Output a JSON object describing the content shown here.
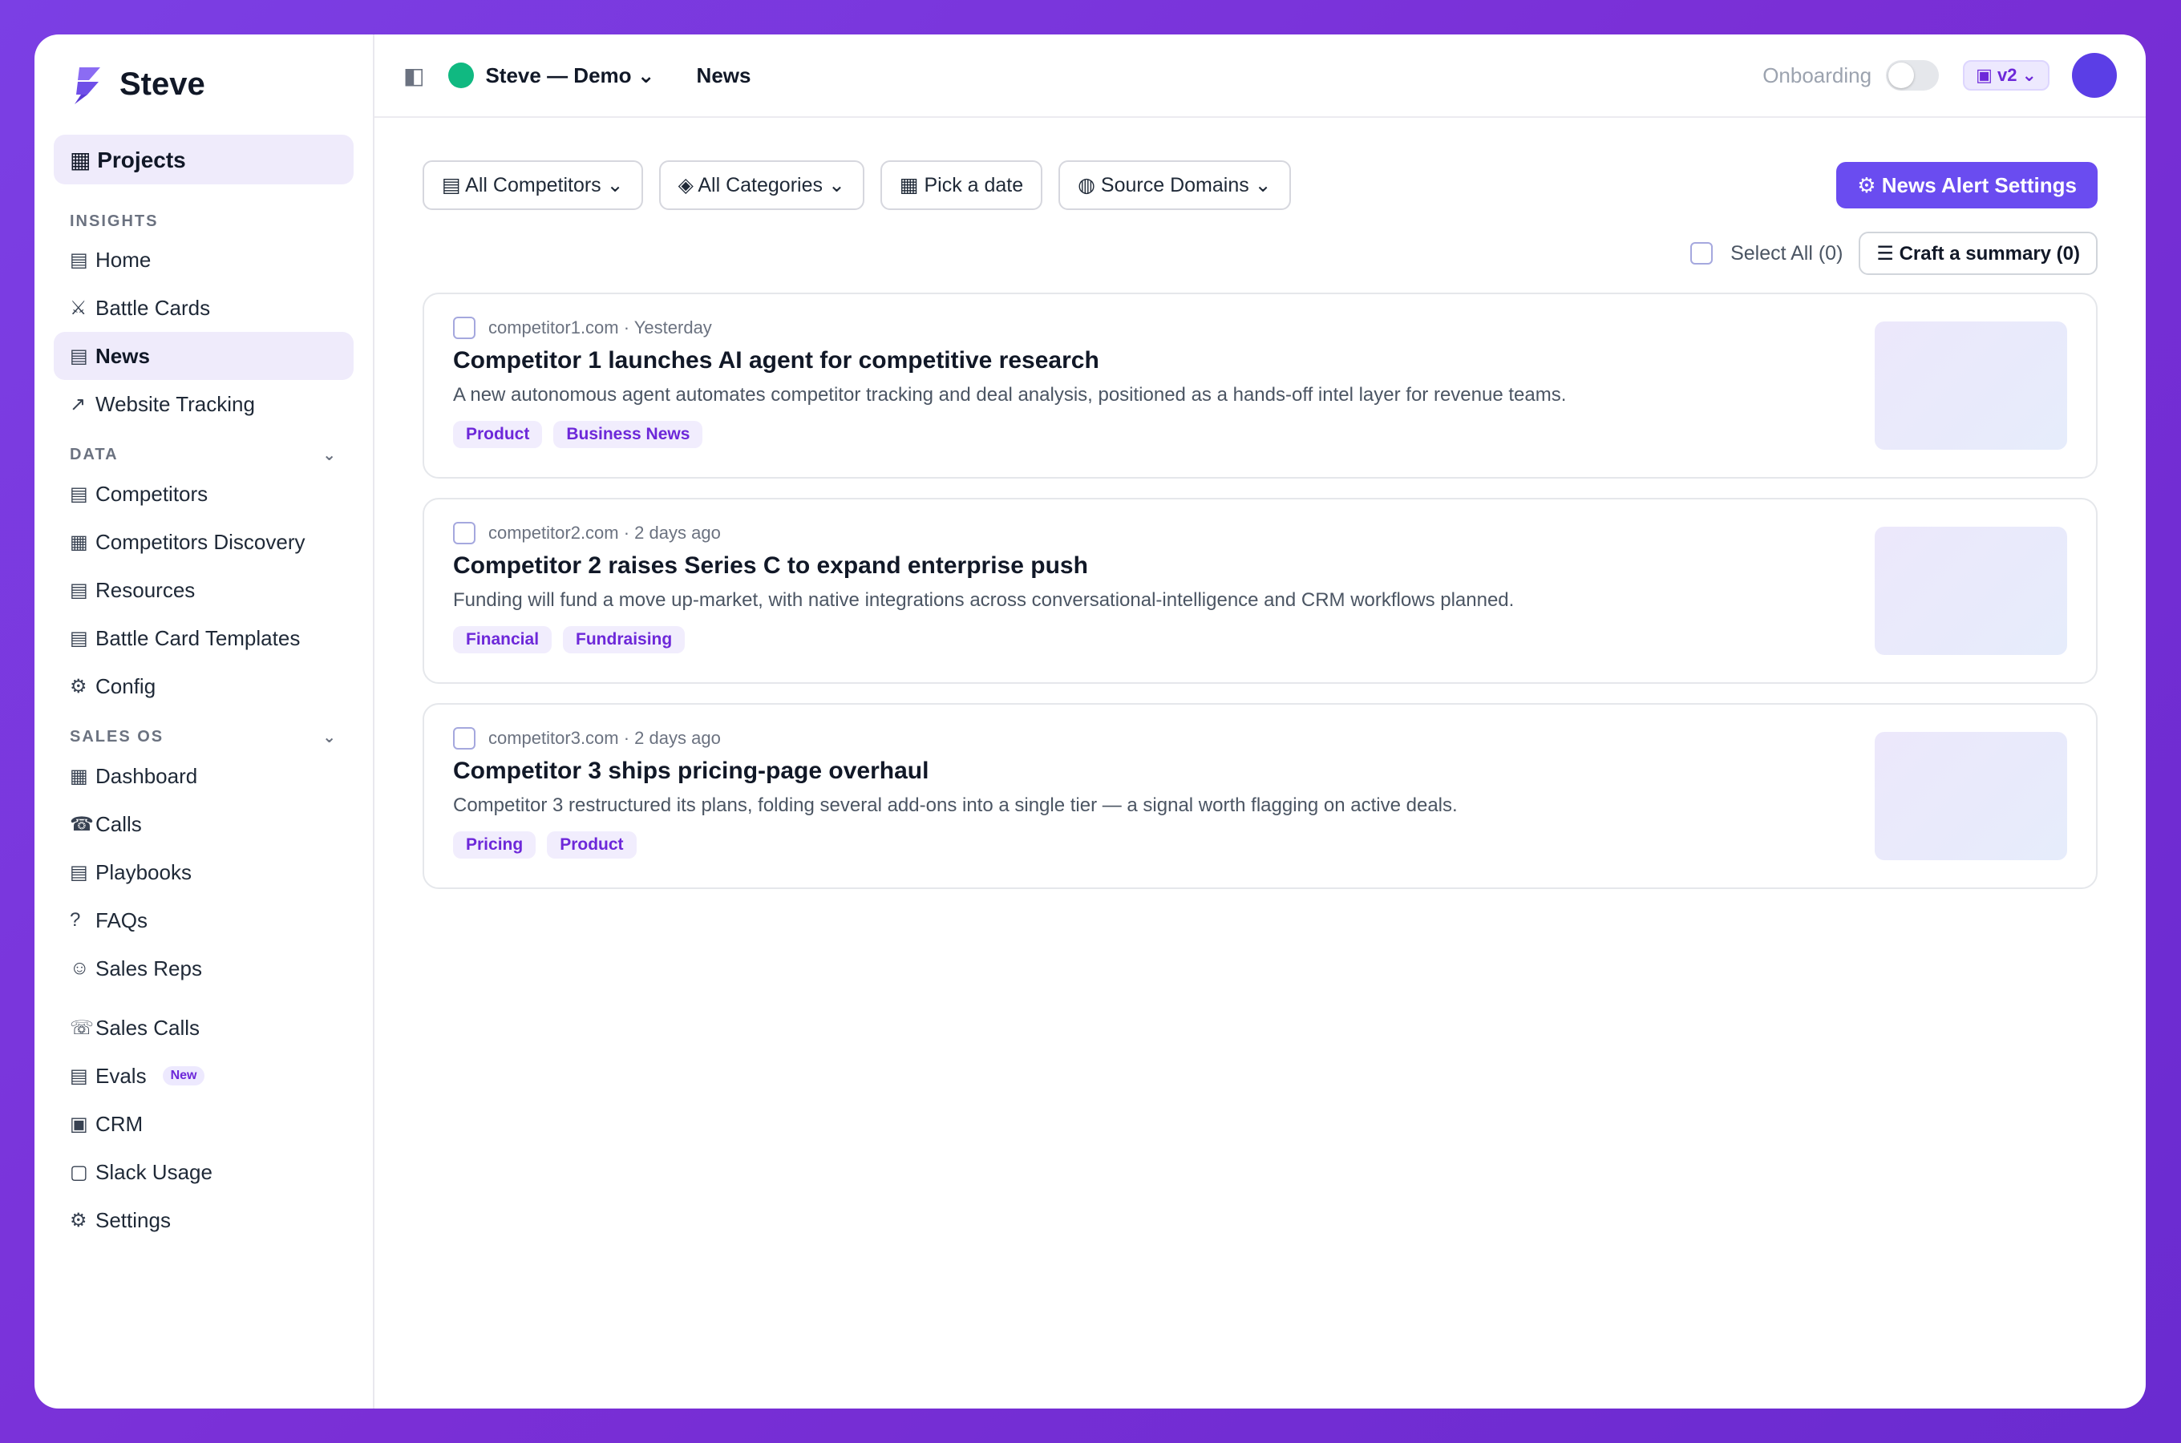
{
  "brand": {
    "name": "Steve",
    "logo_icon": "bolt-logo-icon"
  },
  "sidebar": {
    "projects_label": "▦ Projects",
    "sections": [
      {
        "label": "INSIGHTS",
        "collapsible": false
      },
      {
        "label": "DATA",
        "collapsible": true
      },
      {
        "label": "SALES OS",
        "collapsible": true
      }
    ],
    "insights": [
      {
        "icon": "▤",
        "label": "Home",
        "active": false
      },
      {
        "icon": "⚔",
        "label": "Battle Cards",
        "active": false
      },
      {
        "icon": "▤",
        "label": "News",
        "active": true
      },
      {
        "icon": "↗",
        "label": "Website Tracking",
        "active": false
      }
    ],
    "data": [
      {
        "icon": "▤",
        "label": "Competitors"
      },
      {
        "icon": "▦",
        "label": "Competitors Discovery"
      },
      {
        "icon": "▤",
        "label": "Resources"
      },
      {
        "icon": "▤",
        "label": "Battle Card Templates"
      },
      {
        "icon": "⚙",
        "label": "Config"
      }
    ],
    "sales_os": [
      {
        "icon": "▦",
        "label": "Dashboard"
      },
      {
        "icon": "☎",
        "label": "Calls"
      },
      {
        "icon": "▤",
        "label": "Playbooks"
      },
      {
        "icon": "?",
        "label": "FAQs"
      },
      {
        "icon": "☺",
        "label": "Sales Reps"
      }
    ],
    "other": [
      {
        "icon": "☏",
        "label": "Sales Calls"
      },
      {
        "icon": "▤",
        "label": "Evals",
        "badge": "New"
      },
      {
        "icon": "▣",
        "label": "CRM"
      },
      {
        "icon": "▢",
        "label": "Slack Usage"
      },
      {
        "icon": "⚙",
        "label": "Settings"
      }
    ],
    "chevron": "⌄"
  },
  "topbar": {
    "panel_icon": "◧",
    "project_name": "Steve — Demo ⌄",
    "breadcrumb": "News",
    "onboarding_label": "Onboarding",
    "onboarding_on": false,
    "version_label": "▣ v2 ⌄",
    "status_color": "#10b981",
    "avatar_color": "#5b3ee6"
  },
  "filters": {
    "competitors": "▤ All Competitors ⌄",
    "categories": "◈ All Categories ⌄",
    "date": "▦ Pick a date",
    "domains": "◍ Source Domains ⌄",
    "alert_settings": "⚙ News Alert Settings"
  },
  "selection": {
    "select_all": "Select All (0)",
    "craft_summary": "☰ Craft a summary (0)"
  },
  "news": [
    {
      "meta": "competitor1.com · Yesterday",
      "title": "Competitor 1 launches AI agent for competitive research",
      "desc": "A new autonomous agent automates competitor tracking and deal analysis, positioned as a hands-off intel layer for revenue teams.",
      "tags": [
        "Product",
        "Business News"
      ]
    },
    {
      "meta": "competitor2.com · 2 days ago",
      "title": "Competitor 2 raises Series C to expand enterprise push",
      "desc": "Funding will fund a move up-market, with native integrations across conversational-intelligence and CRM workflows planned.",
      "tags": [
        "Financial",
        "Fundraising"
      ]
    },
    {
      "meta": "competitor3.com · 2 days ago",
      "title": "Competitor 3 ships pricing-page overhaul",
      "desc": "Competitor 3 restructured its plans, folding several add-ons into a single tier — a signal worth flagging on active deals.",
      "tags": [
        "Pricing",
        "Product"
      ]
    }
  ],
  "colors": {
    "accent": "#6a4cf0",
    "tag_text": "#6d28d9",
    "background_gradient_start": "#7b3fe4"
  }
}
